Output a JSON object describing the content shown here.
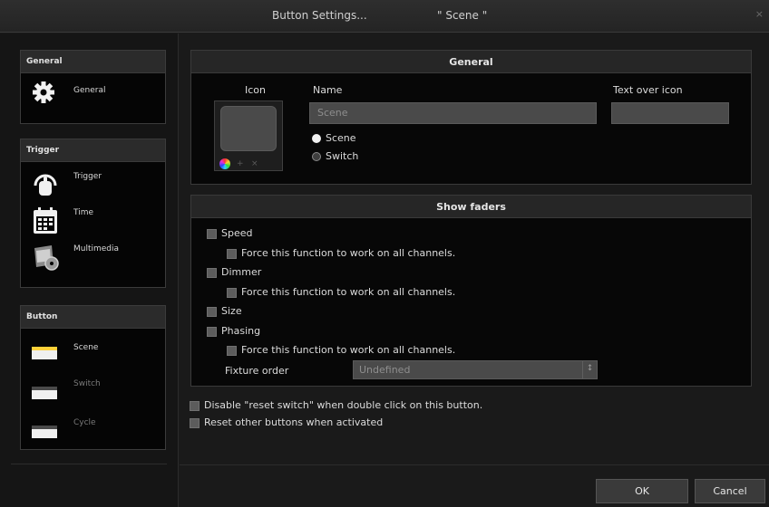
{
  "window": {
    "title": "Button Settings...",
    "scene_name": "\" Scene \"",
    "close_glyph": "×"
  },
  "sidebar": {
    "general": {
      "header": "General",
      "items": [
        {
          "label": "General",
          "icon": "gear-icon"
        }
      ]
    },
    "trigger": {
      "header": "Trigger",
      "items": [
        {
          "label": "Trigger",
          "icon": "hand-trigger-icon"
        },
        {
          "label": "Time",
          "icon": "calendar-icon"
        },
        {
          "label": "Multimedia",
          "icon": "multimedia-icon"
        }
      ]
    },
    "button": {
      "header": "Button",
      "items": [
        {
          "label": "Scene",
          "icon": "scene-button-icon"
        },
        {
          "label": "Switch",
          "icon": "switch-button-icon"
        },
        {
          "label": "Cycle",
          "icon": "cycle-button-icon"
        }
      ]
    }
  },
  "general_panel": {
    "header": "General",
    "icon_label": "Icon",
    "name_label": "Name",
    "name_value": "Scene",
    "text_over_icon_label": "Text over icon",
    "text_over_icon_value": "",
    "mode_options": [
      {
        "label": "Scene",
        "selected": true
      },
      {
        "label": "Switch",
        "selected": false
      }
    ],
    "icon_box_controls": {
      "add": "+",
      "remove": "×"
    }
  },
  "faders_panel": {
    "header": "Show faders",
    "options": {
      "speed": "Speed",
      "dimmer": "Dimmer",
      "size": "Size",
      "phasing": "Phasing"
    },
    "force_label": "Force this function to work on all channels.",
    "fixture_order_label": "Fixture order",
    "fixture_order_value": "Undefined",
    "select_arrow": "↕"
  },
  "bottom_options": {
    "disable_reset": "Disable \"reset switch\" when double click on this button.",
    "reset_others": "Reset other buttons when activated"
  },
  "footer": {
    "ok": "OK",
    "cancel": "Cancel"
  },
  "colors": {
    "background": "#1a1a1a",
    "panel": "#070707",
    "header": "#262626",
    "field": "#4a4a4a"
  }
}
